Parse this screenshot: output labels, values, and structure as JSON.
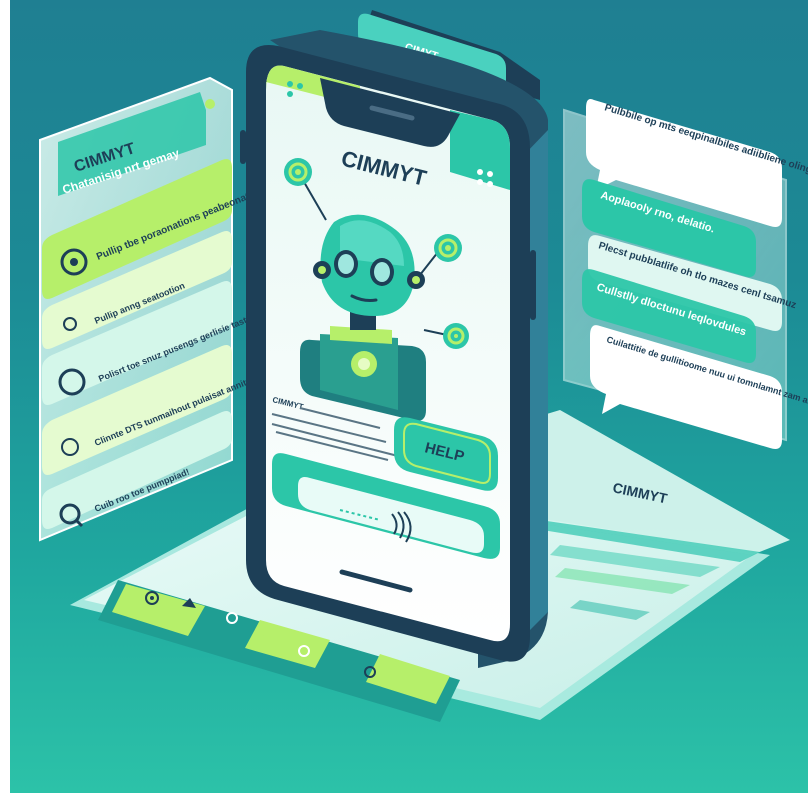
{
  "brand": "CIMMYT",
  "phone": {
    "title": "CIMMYT",
    "help_button": "HELP",
    "body_label": "CIMMYT",
    "body_lines": [
      "CIMMYT — ...",
      "...",
      "..."
    ]
  },
  "top_tag": "CIMYT",
  "left_panel": {
    "brand": "CIMMYT",
    "subtitle": "Chatanisig nrt gemay",
    "items": [
      {
        "label": "Pullip tbe poraonations peabeonate uapacle",
        "icon": "target-icon"
      },
      {
        "label": "Pullip anng seatootion",
        "icon": "pin-icon"
      },
      {
        "label": "Polisrt toe snuz pusengs gerlisie taste",
        "icon": "circle-icon"
      },
      {
        "label": "Clinnte DTS tunmaihout pulaisat annity",
        "icon": "leaf-icon"
      },
      {
        "label": "Cuib roo toe pumppiad!",
        "icon": "search-icon"
      }
    ]
  },
  "right_panel": {
    "bubbles": [
      "Pulbbile op mts eeqpinalbiles adiibliene olingopy nu coutl yanlour mueund ovywclly",
      "Aoplaooly rno, delatio.",
      "Plecst pubblatlife oh tlo mazes cenl tsamuz",
      "Cullstlly dloctunu leqlovdules",
      "Cuilattitie de gullitioome nuu ui tomnlamnt zam alemtel tlall ospacts deetuno and deotion."
    ]
  },
  "document": {
    "title": "CIMMYT"
  },
  "colors": {
    "bg_top": "#1f7f92",
    "bg_bottom": "#2cc2a8",
    "phone_frame": "#1d3f57",
    "accent_green": "#b6ef6a",
    "accent_teal": "#2cc6a8",
    "robot_body": "#2a9f90"
  }
}
